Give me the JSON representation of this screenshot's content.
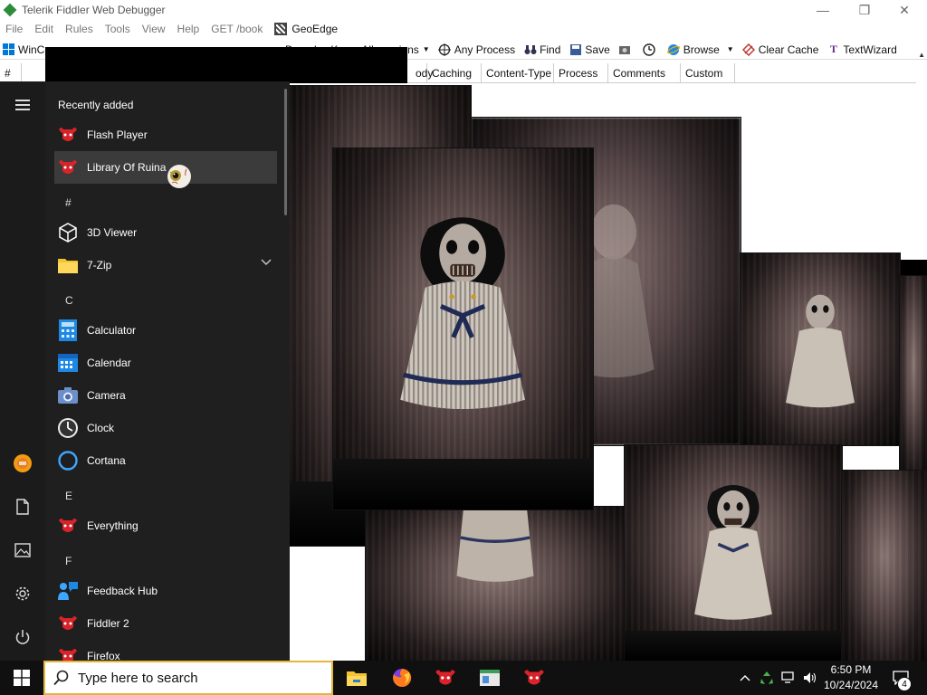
{
  "fiddler": {
    "title": "Telerik Fiddler Web Debugger",
    "menu": [
      "File",
      "Edit",
      "Rules",
      "Tools",
      "View",
      "Help",
      "GET /book"
    ],
    "geoedge": "GeoEdge",
    "toolbar": {
      "winconfig": "WinCo",
      "decode": "Decode",
      "keep_sessions": "Keep: All sessions",
      "any_process": "Any Process",
      "find": "Find",
      "save": "Save",
      "browse": "Browse",
      "clear_cache": "Clear Cache",
      "textwizard": "TextWizard"
    },
    "columns": [
      "#",
      "ody",
      "Caching",
      "Content-Type",
      "Process",
      "Comments",
      "Custom"
    ]
  },
  "start_menu": {
    "recently_added_title": "Recently added",
    "recent_apps": [
      {
        "label": "Flash Player",
        "icon": "red-bull-icon"
      },
      {
        "label": "Library Of Ruina",
        "icon": "red-bull-icon"
      }
    ],
    "groups": [
      {
        "letter": "#",
        "apps": [
          {
            "label": "3D Viewer",
            "icon": "cube-icon"
          },
          {
            "label": "7-Zip",
            "icon": "folder-icon",
            "expandable": true
          }
        ]
      },
      {
        "letter": "C",
        "apps": [
          {
            "label": "Calculator",
            "icon": "calculator-icon"
          },
          {
            "label": "Calendar",
            "icon": "calendar-icon"
          },
          {
            "label": "Camera",
            "icon": "camera-icon"
          },
          {
            "label": "Clock",
            "icon": "clock-icon"
          },
          {
            "label": "Cortana",
            "icon": "cortana-icon"
          }
        ]
      },
      {
        "letter": "E",
        "apps": [
          {
            "label": "Everything",
            "icon": "red-bull-icon"
          }
        ]
      },
      {
        "letter": "F",
        "apps": [
          {
            "label": "Feedback Hub",
            "icon": "feedback-icon"
          },
          {
            "label": "Fiddler 2",
            "icon": "red-bull-icon"
          },
          {
            "label": "Firefox",
            "icon": "red-bull-icon"
          }
        ]
      }
    ]
  },
  "taskbar": {
    "search_placeholder": "Type here to search",
    "time": "6:50 PM",
    "date": "10/24/2024",
    "notification_count": "4"
  },
  "colors": {
    "start_bg": "#1f1f1f",
    "rail_bg": "#1b1b1b",
    "highlight": "#3b3b3b",
    "taskbar_bg": "#101010",
    "search_border": "#e6b43c",
    "bull_red": "#d8232a"
  }
}
